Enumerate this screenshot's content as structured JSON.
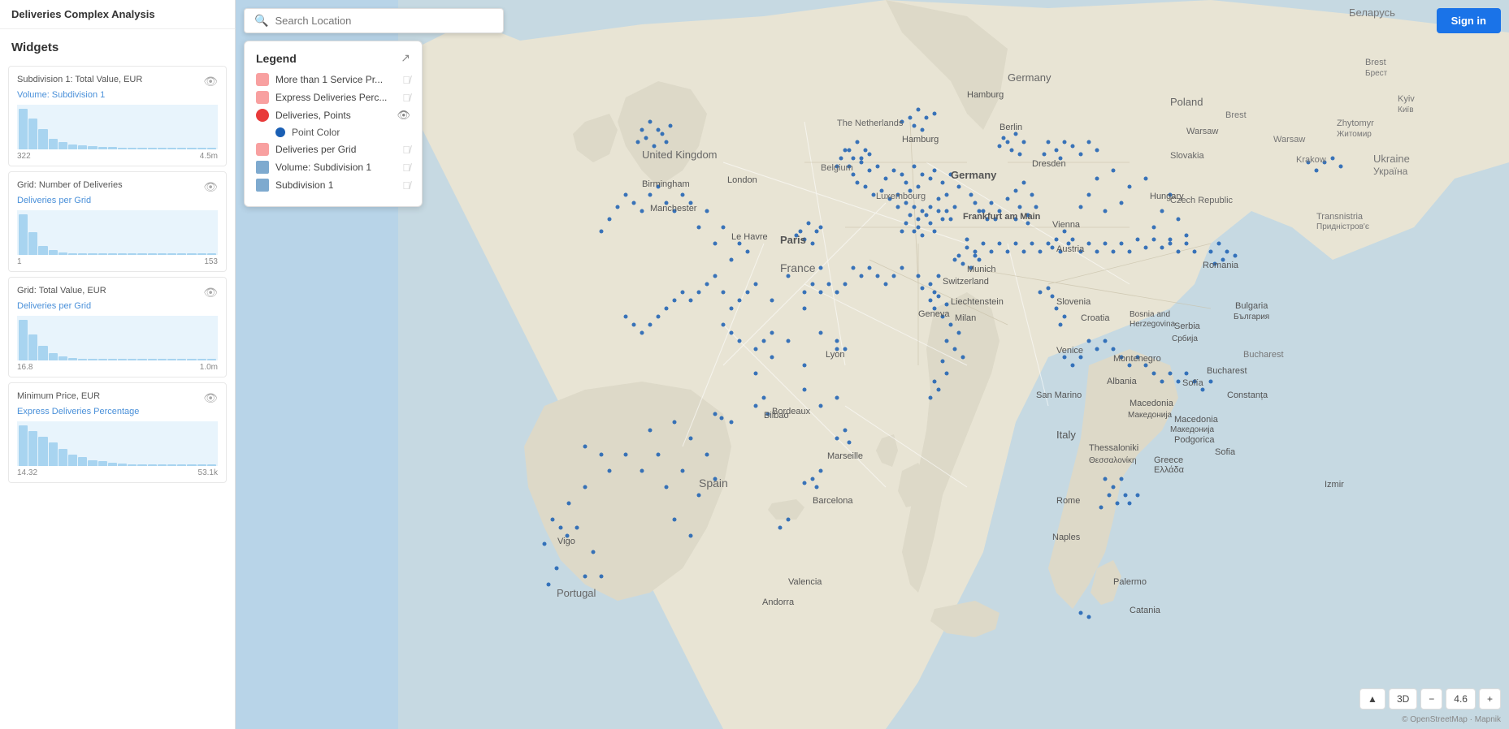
{
  "app": {
    "title": "Deliveries Complex Analysis"
  },
  "sidebar": {
    "widgets_label": "Widgets",
    "cards": [
      {
        "title": "Subdivision 1: Total Value, EUR",
        "subtitle": "Volume: Subdivision 1",
        "range_min": "322",
        "range_max": "4.5m",
        "bars": [
          80,
          60,
          40,
          20,
          15,
          10,
          8,
          6,
          5,
          4,
          3,
          3,
          2,
          2,
          2,
          2,
          2,
          1,
          1,
          1
        ]
      },
      {
        "title": "Grid: Number of Deliveries",
        "subtitle": "Deliveries per Grid",
        "range_min": "1",
        "range_max": "153",
        "bars": [
          90,
          50,
          20,
          10,
          6,
          4,
          3,
          2,
          2,
          2,
          1,
          1,
          1,
          1,
          1,
          1,
          1,
          1,
          1,
          1
        ]
      },
      {
        "title": "Grid: Total Value, EUR",
        "subtitle": "Deliveries per Grid",
        "range_min": "16.8",
        "range_max": "1.0m",
        "bars": [
          85,
          55,
          30,
          15,
          8,
          5,
          4,
          3,
          2,
          2,
          2,
          1,
          1,
          1,
          1,
          1,
          1,
          1,
          1,
          1
        ]
      },
      {
        "title": "Minimum Price, EUR",
        "subtitle": "Express Deliveries Percentage",
        "range_min": "14.32",
        "range_max": "53.1k",
        "bars": [
          70,
          60,
          50,
          40,
          30,
          20,
          15,
          10,
          8,
          5,
          4,
          3,
          2,
          2,
          1,
          1,
          1,
          1,
          1,
          1
        ]
      }
    ]
  },
  "search": {
    "placeholder": "Search Location"
  },
  "signin": {
    "label": "Sign in"
  },
  "legend": {
    "title": "Legend",
    "items": [
      {
        "id": "more-than-service",
        "label": "More than 1 Service Pr...",
        "icon_color": "pink",
        "visible": false
      },
      {
        "id": "express-deliveries",
        "label": "Express Deliveries Perc...",
        "icon_color": "pink",
        "visible": false
      },
      {
        "id": "deliveries-points",
        "label": "Deliveries, Points",
        "icon_color": "red",
        "visible": true,
        "sub_items": [
          {
            "id": "point-color",
            "label": "Point Color",
            "color": "#1a5fb4"
          }
        ]
      },
      {
        "id": "deliveries-per-grid",
        "label": "Deliveries per Grid",
        "icon_color": "pink-square",
        "visible": false
      },
      {
        "id": "volume-subdivision",
        "label": "Volume: Subdivision 1",
        "icon_color": "blue-square",
        "visible": false
      },
      {
        "id": "subdivision1",
        "label": "Subdivision 1",
        "icon_color": "blue-square",
        "visible": false
      }
    ]
  },
  "map_controls": {
    "terrain_label": "▲",
    "three_d_label": "3D",
    "zoom_minus": "−",
    "zoom_level": "4.6",
    "zoom_plus": "+"
  },
  "map_attribution": "© OpenStreetMap · Mapnik"
}
